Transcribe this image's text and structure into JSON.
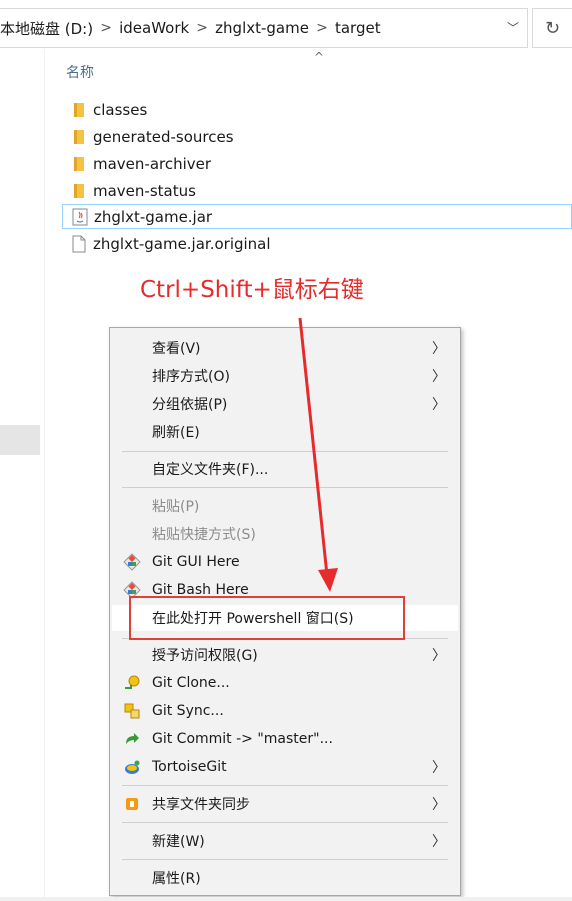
{
  "address_bar": {
    "crumbs": [
      "本地磁盘 (D:)",
      "ideaWork",
      "zhglxt-game",
      "target"
    ],
    "separator": ">",
    "dropdown_glyph": "﹀",
    "refresh_glyph": "↻"
  },
  "column_header": {
    "name_label": "名称",
    "sort_glyph": "^"
  },
  "files": [
    {
      "name": "classes",
      "icon": "folder-icon"
    },
    {
      "name": "generated-sources",
      "icon": "folder-icon"
    },
    {
      "name": "maven-archiver",
      "icon": "folder-icon"
    },
    {
      "name": "maven-status",
      "icon": "folder-icon"
    },
    {
      "name": "zhglxt-game.jar",
      "icon": "java-jar-icon",
      "selected": true
    },
    {
      "name": "zhglxt-game.jar.original",
      "icon": "file-icon"
    }
  ],
  "annotation": {
    "text": "Ctrl+Shift+鼠标右键",
    "color": "#e52b2b"
  },
  "context_menu": {
    "items": [
      {
        "label": "查看(V)",
        "submenu": true
      },
      {
        "label": "排序方式(O)",
        "submenu": true
      },
      {
        "label": "分组依据(P)",
        "submenu": true
      },
      {
        "label": "刷新(E)"
      },
      {
        "label": "自定义文件夹(F)..."
      },
      {
        "label": "粘贴(P)",
        "disabled": true
      },
      {
        "label": "粘贴快捷方式(S)",
        "disabled": true
      },
      {
        "label": "Git GUI Here",
        "icon": "git-diamond-icon"
      },
      {
        "label": "Git Bash Here",
        "icon": "git-diamond-icon"
      },
      {
        "label": "在此处打开 Powershell 窗口(S)",
        "highlighted": true
      },
      {
        "label": "授予访问权限(G)",
        "submenu": true
      },
      {
        "label": "Git Clone...",
        "icon": "tortoise-clone-icon"
      },
      {
        "label": "Git Sync...",
        "icon": "tortoise-sync-icon"
      },
      {
        "label": "Git Commit -> \"master\"...",
        "icon": "tortoise-commit-icon"
      },
      {
        "label": "TortoiseGit",
        "icon": "tortoisegit-icon",
        "submenu": true
      },
      {
        "label": "共享文件夹同步",
        "icon": "share-sync-icon",
        "submenu": true
      },
      {
        "label": "新建(W)",
        "submenu": true
      },
      {
        "label": "属性(R)"
      }
    ],
    "submenu_glyph": "〉"
  },
  "colors": {
    "accent_red": "#e0403a",
    "selection_border": "#99d1ff",
    "menu_bg": "#f2f2f2"
  }
}
